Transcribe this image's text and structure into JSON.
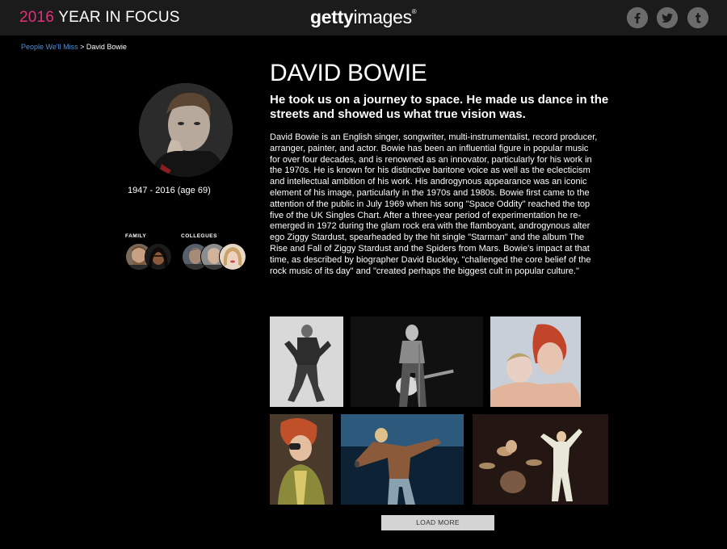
{
  "header": {
    "year": "2016",
    "title_rest": " YEAR IN FOCUS",
    "logo_bold": "getty",
    "logo_light": "images",
    "logo_mark": "®",
    "social": [
      "facebook-icon",
      "twitter-icon",
      "tumblr-icon"
    ]
  },
  "breadcrumb": {
    "parent": "People We'll Miss",
    "separator": " > ",
    "current": "David Bowie"
  },
  "profile": {
    "lifespan": "1947 - 2016 (age 69)",
    "family_label": "FAMILY",
    "colleagues_label": "COLLEGUES"
  },
  "article": {
    "title": "DAVID BOWIE",
    "subtitle": "He took us on a journey to space. He made us dance in the streets and showed us what true vision was.",
    "bio": "David Bowie is an English singer, songwriter, multi-instrumentalist, record producer, arranger, painter, and actor. Bowie has been an influential figure in popular music for over four decades, and is renowned as an innovator, particularly for his work in the 1970s. He is known for his distinctive baritone voice as well as the eclecticism and intellectual ambition of his work. His androgynous appearance was an iconic element of his image, particularly in the 1970s and 1980s. Bowie first came to the attention of the public in July 1969 when his song \"Space Oddity\" reached the top five of the UK Singles Chart. After a three-year period of experimentation he re-emerged in 1972 during the glam rock era with the flamboyant, androgynous alter ego Ziggy Stardust, spearheaded by the hit single \"Starman\" and the album The Rise and Fall of Ziggy Stardust and the Spiders from Mars. Bowie's impact at that time, as described by biographer David Buckley, \"challenged the core belief of the rock music of its day\" and \"created perhaps the biggest cult in popular culture.\""
  },
  "load_more": "LOAD MORE",
  "colors": {
    "accent": "#e1317b",
    "link": "#4f8fd6",
    "topbar": "#1b1b1b",
    "button": "#d4d4d4"
  }
}
